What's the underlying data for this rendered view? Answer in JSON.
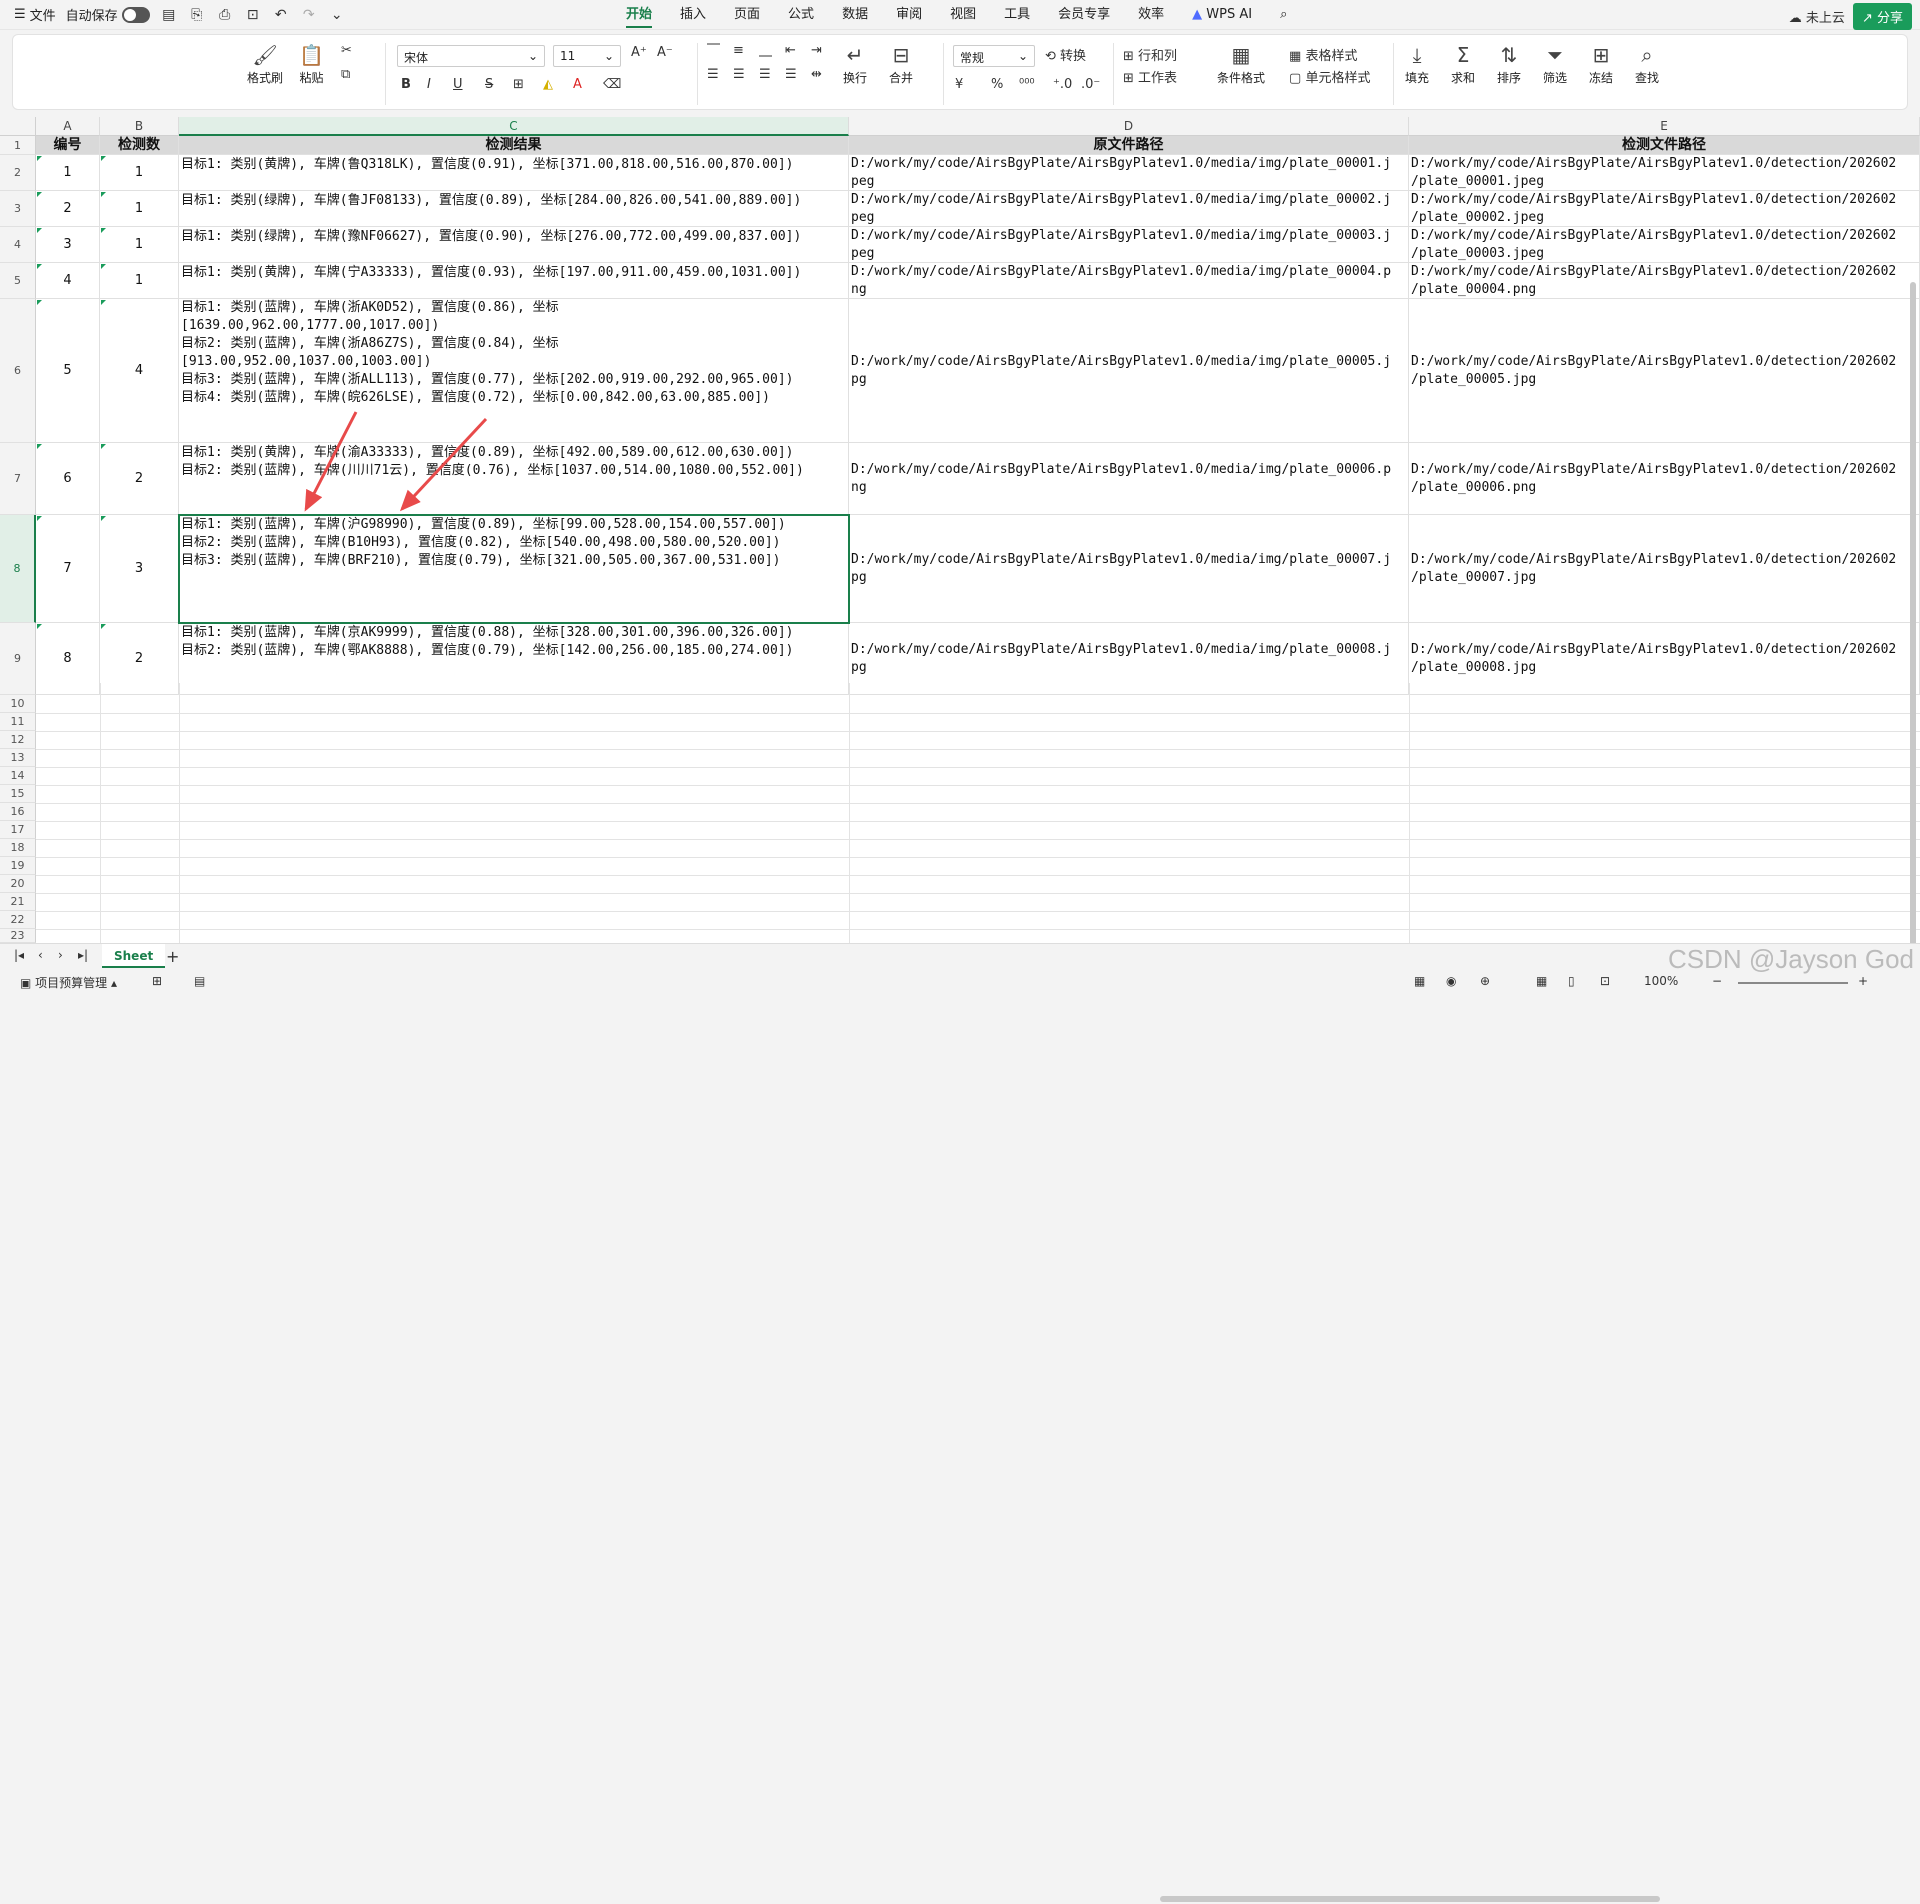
{
  "app": {
    "file_menu": "文件",
    "autosave_label": "自动保存",
    "tabs": [
      "开始",
      "插入",
      "页面",
      "公式",
      "数据",
      "审阅",
      "视图",
      "工具",
      "会员专享",
      "效率",
      "WPS AI"
    ],
    "active_tab": "开始",
    "cloud_status": "未上云",
    "share_label": "分享"
  },
  "ribbon": {
    "format_painter": "格式刷",
    "paste": "粘贴",
    "font_name": "宋体",
    "font_size": "11",
    "wrap": "换行",
    "merge": "合并",
    "number_format": "常规",
    "convert": "转换",
    "row_col": "行和列",
    "worksheet": "工作表",
    "conditional_format": "条件格式",
    "table_style": "表格样式",
    "cell_style": "单元格样式",
    "fill": "填充",
    "sum": "求和",
    "sort": "排序",
    "filter": "筛选",
    "freeze": "冻结",
    "find": "查找"
  },
  "sheet": {
    "columns": [
      "A",
      "B",
      "C",
      "D",
      "E"
    ],
    "headers": [
      "编号",
      "检测数",
      "检测结果",
      "原文件路径",
      "检测文件路径"
    ],
    "row_numbers": [
      "1",
      "2",
      "3",
      "4",
      "5",
      "6",
      "7",
      "8",
      "9",
      "10",
      "11",
      "12",
      "13",
      "14",
      "15",
      "16",
      "17",
      "18",
      "19",
      "20",
      "21",
      "22",
      "23"
    ],
    "rows": [
      {
        "a": "1",
        "b": "1",
        "c": "目标1: 类别(黄牌), 车牌(鲁Q318LK), 置信度(0.91), 坐标[371.00,818.00,516.00,870.00])",
        "d": "D:/work/my/code/AirsBgyPlate/AirsBgyPlatev1.0/media/img/plate_00001.j\npeg",
        "e": "D:/work/my/code/AirsBgyPlate/AirsBgyPlatev1.0/detection/202602\n/plate_00001.jpeg"
      },
      {
        "a": "2",
        "b": "1",
        "c": "目标1: 类别(绿牌), 车牌(鲁JF08133), 置信度(0.89), 坐标[284.00,826.00,541.00,889.00])",
        "d": "D:/work/my/code/AirsBgyPlate/AirsBgyPlatev1.0/media/img/plate_00002.j\npeg",
        "e": "D:/work/my/code/AirsBgyPlate/AirsBgyPlatev1.0/detection/202602\n/plate_00002.jpeg"
      },
      {
        "a": "3",
        "b": "1",
        "c": "目标1: 类别(绿牌), 车牌(豫NF06627), 置信度(0.90), 坐标[276.00,772.00,499.00,837.00])",
        "d": "D:/work/my/code/AirsBgyPlate/AirsBgyPlatev1.0/media/img/plate_00003.j\npeg",
        "e": "D:/work/my/code/AirsBgyPlate/AirsBgyPlatev1.0/detection/202602\n/plate_00003.jpeg"
      },
      {
        "a": "4",
        "b": "1",
        "c": "目标1: 类别(黄牌), 车牌(宁A33333), 置信度(0.93), 坐标[197.00,911.00,459.00,1031.00])",
        "d": "D:/work/my/code/AirsBgyPlate/AirsBgyPlatev1.0/media/img/plate_00004.p\nng",
        "e": "D:/work/my/code/AirsBgyPlate/AirsBgyPlatev1.0/detection/202602\n/plate_00004.png"
      },
      {
        "a": "5",
        "b": "4",
        "c": "目标1: 类别(蓝牌), 车牌(浙AK0D52), 置信度(0.86), 坐标\n[1639.00,962.00,1777.00,1017.00])\n目标2: 类别(蓝牌), 车牌(浙A86Z7S), 置信度(0.84), 坐标\n[913.00,952.00,1037.00,1003.00])\n目标3: 类别(蓝牌), 车牌(浙ALL113), 置信度(0.77), 坐标[202.00,919.00,292.00,965.00])\n目标4: 类别(蓝牌), 车牌(皖626LSE), 置信度(0.72), 坐标[0.00,842.00,63.00,885.00])",
        "d": "D:/work/my/code/AirsBgyPlate/AirsBgyPlatev1.0/media/img/plate_00005.j\npg",
        "e": "D:/work/my/code/AirsBgyPlate/AirsBgyPlatev1.0/detection/202602\n/plate_00005.jpg"
      },
      {
        "a": "6",
        "b": "2",
        "c": "目标1: 类别(黄牌), 车牌(渝A33333), 置信度(0.89), 坐标[492.00,589.00,612.00,630.00])\n目标2: 类别(蓝牌), 车牌(川川71云), 置信度(0.76), 坐标[1037.00,514.00,1080.00,552.00])",
        "d": "D:/work/my/code/AirsBgyPlate/AirsBgyPlatev1.0/media/img/plate_00006.p\nng",
        "e": "D:/work/my/code/AirsBgyPlate/AirsBgyPlatev1.0/detection/202602\n/plate_00006.png"
      },
      {
        "a": "7",
        "b": "3",
        "c": "目标1: 类别(蓝牌), 车牌(沪G98990), 置信度(0.89), 坐标[99.00,528.00,154.00,557.00])\n目标2: 类别(蓝牌), 车牌(B10H93), 置信度(0.82), 坐标[540.00,498.00,580.00,520.00])\n目标3: 类别(蓝牌), 车牌(BRF210), 置信度(0.79), 坐标[321.00,505.00,367.00,531.00])",
        "d": "D:/work/my/code/AirsBgyPlate/AirsBgyPlatev1.0/media/img/plate_00007.j\npg",
        "e": "D:/work/my/code/AirsBgyPlate/AirsBgyPlatev1.0/detection/202602\n/plate_00007.jpg"
      },
      {
        "a": "8",
        "b": "2",
        "c": "目标1: 类别(蓝牌), 车牌(京AK9999), 置信度(0.88), 坐标[328.00,301.00,396.00,326.00])\n目标2: 类别(蓝牌), 车牌(鄂AK8888), 置信度(0.79), 坐标[142.00,256.00,185.00,274.00])",
        "d": "D:/work/my/code/AirsBgyPlate/AirsBgyPlatev1.0/media/img/plate_00008.j\npg",
        "e": "D:/work/my/code/AirsBgyPlate/AirsBgyPlatev1.0/detection/202602\n/plate_00008.jpg"
      }
    ]
  },
  "bottom": {
    "sheet_tab": "Sheet",
    "add_sheet": "+",
    "project_label": "项目预算管理",
    "zoom": "100%",
    "watermark": "CSDN @Jayson God"
  },
  "colors": {
    "accent": "#1a7f4b",
    "annotation_arrow": "#e84a4a"
  }
}
